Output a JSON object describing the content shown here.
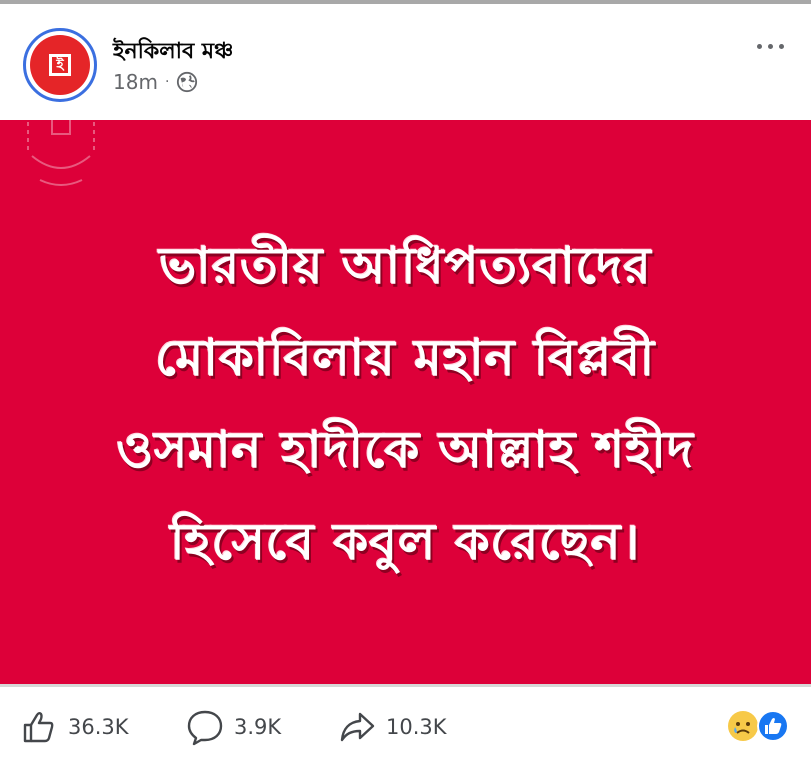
{
  "post": {
    "page_name": "ইনকিলাব মঞ্চ",
    "time": "18m",
    "separator": "·",
    "audience_icon": "globe-icon",
    "avatar_logo_text": "ই",
    "image_text_lines": [
      "ভারতীয় আধিপত্যবাদের",
      "মোকাবিলায় মহান বিপ্লবী",
      "ওসমান হাদীকে আল্লাহ শহীদ",
      "হিসেবে কবুল করেছেন।"
    ],
    "image_background": "#dd0039"
  },
  "actions": {
    "likes": "36.3K",
    "comments": "3.9K",
    "shares": "10.3K"
  },
  "reactions": [
    "sad-emoji-icon",
    "like-reaction-icon"
  ],
  "colors": {
    "brand_blue": "#1877f2",
    "avatar_red": "#e52528",
    "text_secondary": "#65676b"
  }
}
